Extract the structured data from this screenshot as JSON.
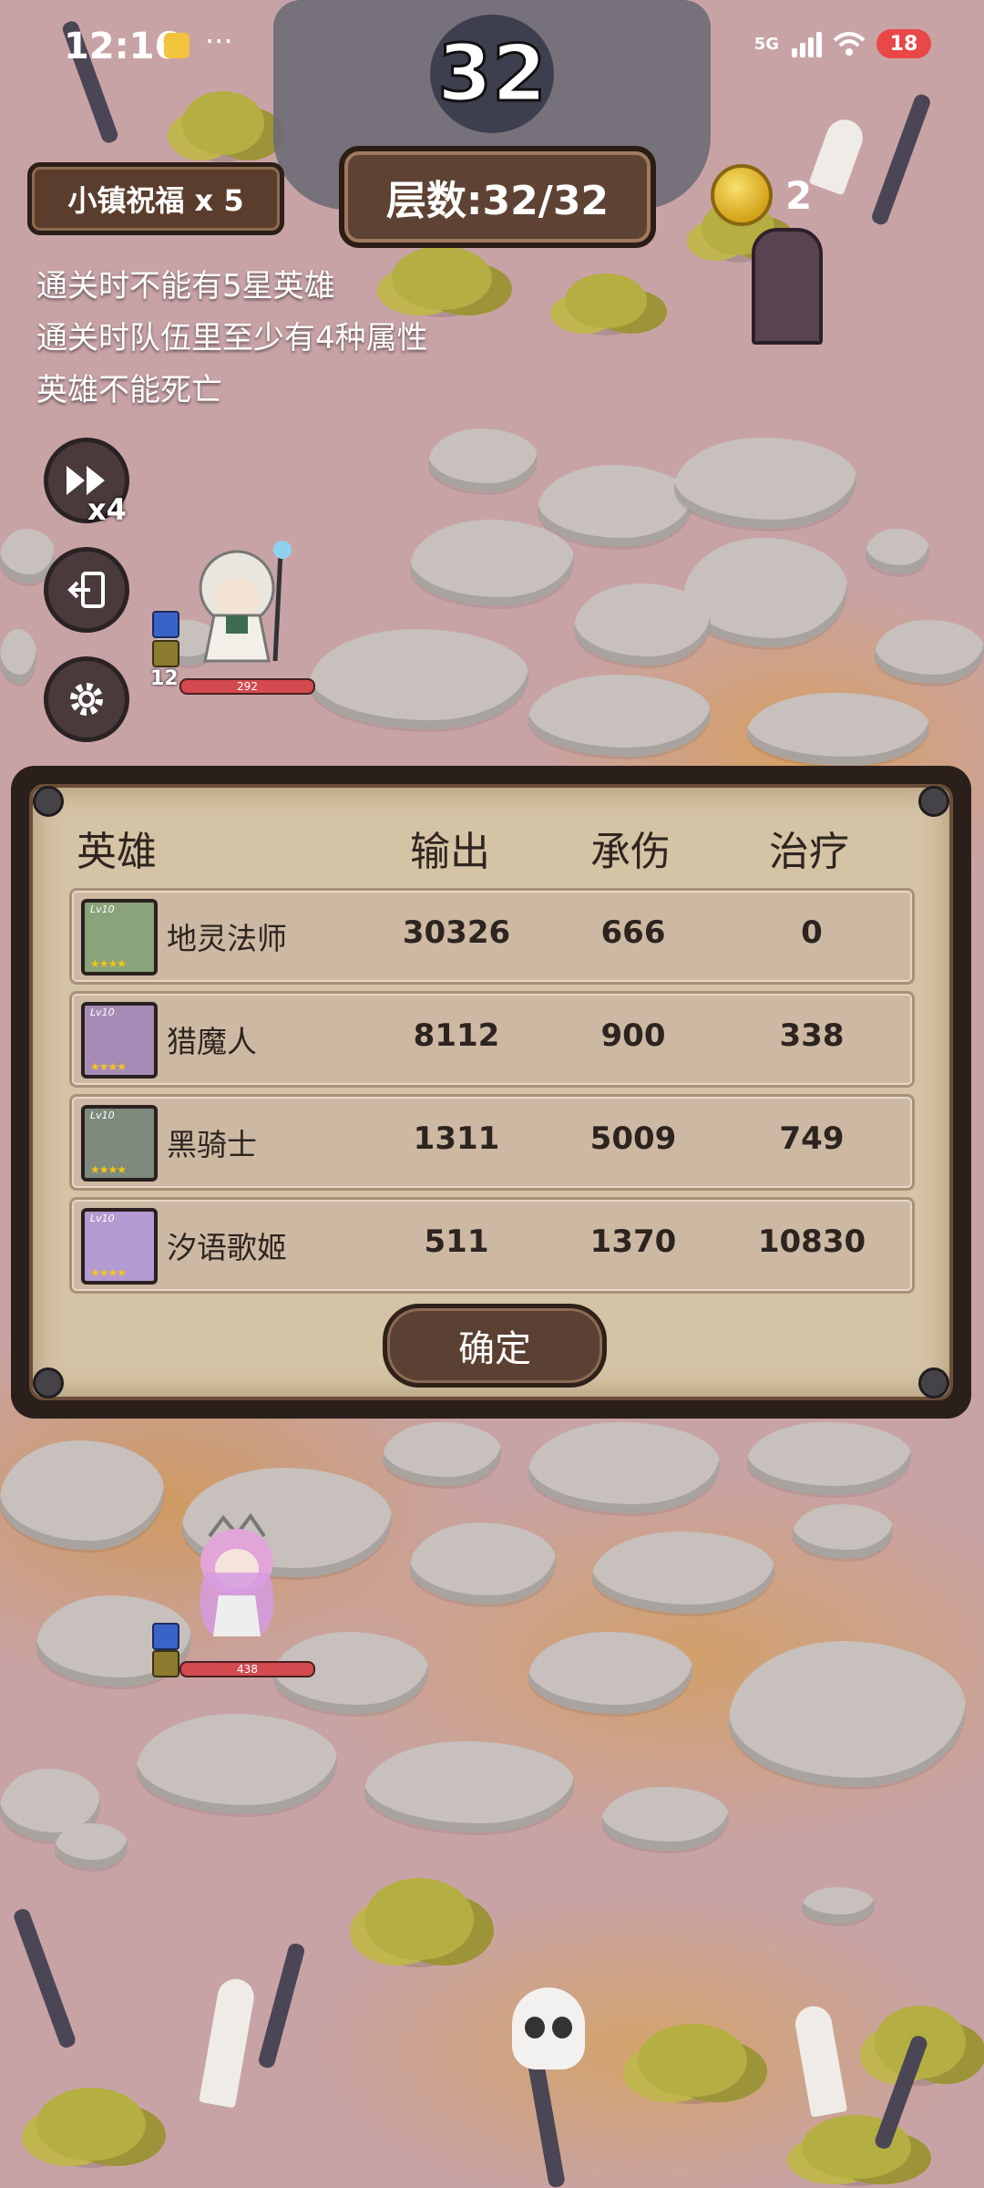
{
  "status_bar": {
    "time": "12:16",
    "dots": "···",
    "network": "5G",
    "battery": "18"
  },
  "hud": {
    "stage_number": "32",
    "blessing": "小镇祝福 x 5",
    "floor": "层数:32/32",
    "coins": "2",
    "speed": "x4"
  },
  "rules": [
    "通关时不能有5星英雄",
    "通关时队伍里至少有4种属性",
    "英雄不能死亡"
  ],
  "field_heroes": [
    {
      "hp": "292",
      "level": "12"
    },
    {
      "hp": "438",
      "level": ""
    }
  ],
  "stats_panel": {
    "headers": {
      "hero": "英雄",
      "damage": "输出",
      "taken": "承伤",
      "heal": "治疗"
    },
    "rows": [
      {
        "name": "地灵法师",
        "damage": "30326",
        "taken": "666",
        "heal": "0",
        "avatar_color": "#8aa37a",
        "lv": "Lv10"
      },
      {
        "name": "猎魔人",
        "damage": "8112",
        "taken": "900",
        "heal": "338",
        "avatar_color": "#a78bb7",
        "lv": "Lv10"
      },
      {
        "name": "黑骑士",
        "damage": "1311",
        "taken": "5009",
        "heal": "749",
        "avatar_color": "#7d8a7d",
        "lv": "Lv10"
      },
      {
        "name": "汐语歌姬",
        "damage": "511",
        "taken": "1370",
        "heal": "10830",
        "avatar_color": "#b39ad0",
        "lv": "Lv10"
      }
    ],
    "confirm_label": "确定"
  },
  "colors": {
    "panel_bg": "#d4c3a4",
    "hp_bar": "#d34a4f",
    "coin": "#f0c93a"
  }
}
